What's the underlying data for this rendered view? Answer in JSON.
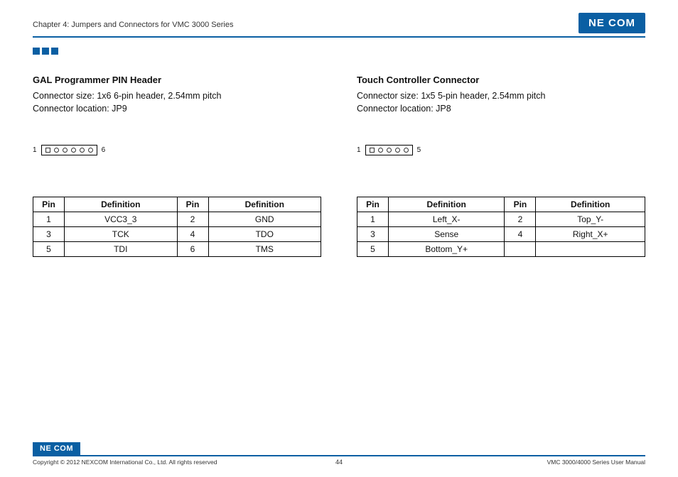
{
  "header": {
    "chapter": "Chapter 4: Jumpers and Connectors for VMC 3000 Series",
    "logo": "NE COM"
  },
  "left": {
    "title": "GAL Programmer PIN Header",
    "size": "Connector size: 1x6 6-pin header, 2.54mm pitch",
    "loc": "Connector location: JP9",
    "pin_start": "1",
    "pin_end": "6",
    "headers": {
      "pin": "Pin",
      "def": "Definition"
    },
    "rows": [
      {
        "p1": "1",
        "d1": "VCC3_3",
        "p2": "2",
        "d2": "GND"
      },
      {
        "p1": "3",
        "d1": "TCK",
        "p2": "4",
        "d2": "TDO"
      },
      {
        "p1": "5",
        "d1": "TDI",
        "p2": "6",
        "d2": "TMS"
      }
    ]
  },
  "right": {
    "title": "Touch Controller Connector",
    "size": "Connector size: 1x5 5-pin header, 2.54mm pitch",
    "loc": "Connector location: JP8",
    "pin_start": "1",
    "pin_end": "5",
    "headers": {
      "pin": "Pin",
      "def": "Definition"
    },
    "rows": [
      {
        "p1": "1",
        "d1": "Left_X-",
        "p2": "2",
        "d2": "Top_Y-"
      },
      {
        "p1": "3",
        "d1": "Sense",
        "p2": "4",
        "d2": "Right_X+"
      },
      {
        "p1": "5",
        "d1": "Bottom_Y+",
        "p2": "",
        "d2": ""
      }
    ]
  },
  "footer": {
    "logo": "NE COM",
    "copyright": "Copyright © 2012 NEXCOM International Co., Ltd. All rights reserved",
    "page": "44",
    "manual": "VMC 3000/4000 Series User Manual"
  }
}
